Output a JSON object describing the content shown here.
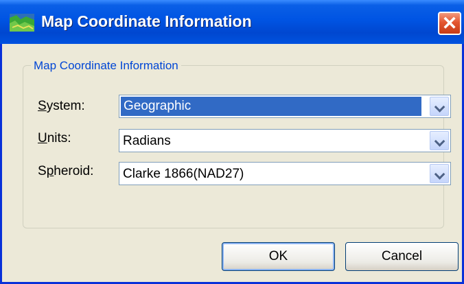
{
  "window": {
    "title": "Map Coordinate Information",
    "close_symbol": "✕",
    "icon": "map-icon"
  },
  "group": {
    "title": "Map Coordinate Information"
  },
  "fields": {
    "system": {
      "label_prefix": "",
      "label_accel": "S",
      "label_rest": "ystem:",
      "value": "Geographic",
      "selected": true
    },
    "units": {
      "label_prefix": "",
      "label_accel": "U",
      "label_rest": "nits:",
      "value": "Radians"
    },
    "spheroid": {
      "label_prefix": "S",
      "label_accel": "p",
      "label_rest": "heroid:",
      "value": "Clarke 1866(NAD27)"
    }
  },
  "buttons": {
    "ok": "OK",
    "cancel": "Cancel"
  },
  "colors": {
    "titlebar": "#0054e3",
    "selection": "#316ac5",
    "group_label": "#0046d5",
    "close_button": "#e45630"
  }
}
